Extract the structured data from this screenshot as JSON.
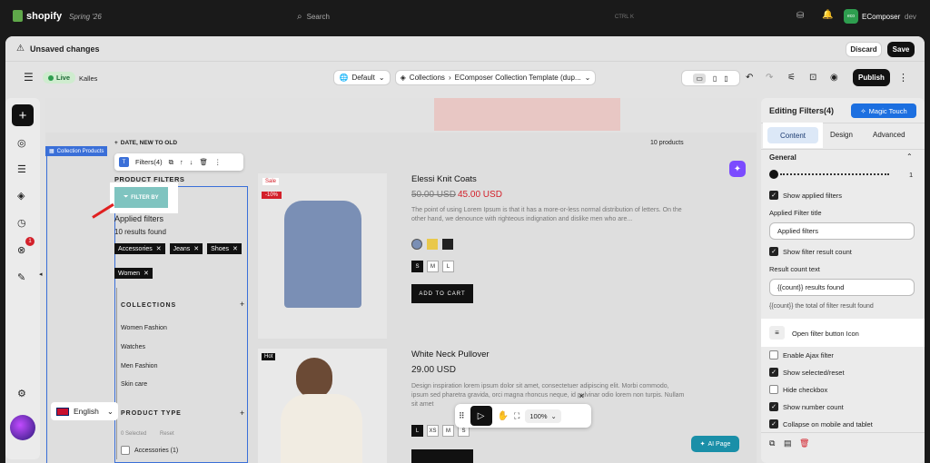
{
  "topbar": {
    "brand": "shopify",
    "edition": "Spring '26",
    "search_placeholder": "Search",
    "shortcut": "CTRL  K",
    "notif_count": "",
    "account_initials": "eco",
    "account_name": "EComposer",
    "account_role": "dev"
  },
  "header": {
    "title": "Unsaved changes",
    "discard": "Discard",
    "save": "Save"
  },
  "toolbar": {
    "live": "Live",
    "theme": "Kalles",
    "device_default": "Default",
    "breadcrumb_1": "Collections",
    "breadcrumb_2": "EComposer Collection Template (dup...",
    "publish": "Publish"
  },
  "sidebar": {
    "badge": "1",
    "language": "English"
  },
  "canvas": {
    "section_tag": "Collection Products",
    "sort_label": "DATE, NEW TO OLD",
    "product_count": "10 products",
    "element_label": "Filters(4)",
    "filter_heading": "PRODUCT FILTERS",
    "filter_by": "FILTER BY",
    "applied_title": "Applied filters",
    "results": "10 results found",
    "tags": [
      "Accessories",
      "Jeans",
      "Shoes",
      "Women"
    ],
    "collections_title": "COLLECTIONS",
    "collections": [
      "Women Fashion",
      "Watches",
      "Men Fashion",
      "Skin care"
    ],
    "product_type_title": "PRODUCT TYPE",
    "pt_selected": "0 Selected",
    "pt_reset": "Reset",
    "pt_first": "Accessories (1)",
    "products": [
      {
        "badge": "Sale",
        "discount": "-10%",
        "name": "Elessi Knit Coats",
        "old_price": "50.00 USD",
        "price": "45.00 USD",
        "desc": "The point of using Lorem Ipsum is that it has a more-or-less normal distribution of letters. On the other hand, we denounce with righteous indignation and dislike men who are...",
        "sizes": [
          "S",
          "M",
          "L"
        ],
        "cta": "ADD TO CART"
      },
      {
        "badge": "Hot",
        "name": "White Neck Pullover",
        "price": "29.00 USD",
        "desc": "Design inspiration lorem ipsum dolor sit amet, consectetuer adipiscing elit. Morbi commodo, ipsum sed pharetra gravida, orci magna rhoncus neque, id pulvinar odio lorem non turpis. Nullam sit amet",
        "sizes": [
          "L",
          "XS",
          "M",
          "S"
        ]
      }
    ],
    "zoom": "100%",
    "ai_page": "AI Page"
  },
  "panel": {
    "title": "Editing Filters(4)",
    "magic": "Magic Touch",
    "tabs": [
      "Content",
      "Design",
      "Advanced"
    ],
    "general": "General",
    "slider_value": "1",
    "show_applied": "Show applied filters",
    "applied_title_label": "Applied Filter title",
    "applied_title_value": "Applied filters",
    "show_result_count": "Show filter result count",
    "result_count_label": "Result count text",
    "result_count_value": "{{count}} results found",
    "result_count_hint": "{{count}} the total of filter result found",
    "open_filter_icon": "Open filter button Icon",
    "enable_ajax": "Enable Ajax filter",
    "show_selected": "Show selected/reset",
    "hide_checkbox": "Hide checkbox",
    "show_number": "Show number count",
    "collapse_mobile": "Collapse on mobile and tablet"
  },
  "colors": {
    "accent_teal": "#7fc4c0",
    "live_green": "#2e9e4f",
    "magic_blue": "#1c6fe0",
    "price_red": "#d3202a"
  }
}
